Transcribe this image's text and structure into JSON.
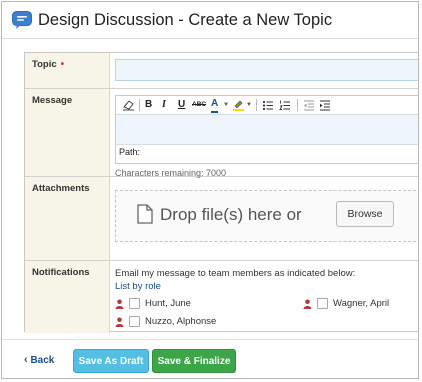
{
  "header": {
    "title": "Design Discussion - Create a New Topic",
    "icon": "chat-bubble-icon"
  },
  "form": {
    "topic": {
      "label": "Topic",
      "required_mark": "•",
      "value": ""
    },
    "message": {
      "label": "Message",
      "toolbar": {
        "items": [
          "eraser-icon",
          "bold-icon",
          "italic-icon",
          "underline-icon",
          "strikethrough-icon",
          "font-color-icon",
          "highlight-color-icon",
          "bulleted-list-icon",
          "numbered-list-icon",
          "decrease-indent-icon",
          "increase-indent-icon"
        ],
        "bold": "B",
        "italic": "I",
        "underline": "U",
        "strike": "ABC",
        "font_color": "A"
      },
      "path_label": "Path:",
      "chars_remaining": "Characters remaining: 7000"
    },
    "attachments": {
      "label": "Attachments",
      "drop_text": "Drop file(s) here or",
      "browse_label": "Browse"
    },
    "notifications": {
      "label": "Notifications",
      "instruction": "Email my message to team members as indicated below:",
      "list_link": "List by role",
      "members": [
        {
          "name": "Hunt, June",
          "checked": false
        },
        {
          "name": "Wagner, April",
          "checked": false
        },
        {
          "name": "Nuzzo, Alphonse",
          "checked": false
        }
      ]
    }
  },
  "footer": {
    "back_label": "Back",
    "back_icon": "chevron-left-icon",
    "save_draft_label": "Save As Draft",
    "save_finalize_label": "Save & Finalize"
  },
  "colors": {
    "required": "#e0303a",
    "link": "#1b4e86",
    "draft": "#52bfe3",
    "finalize": "#3ca548",
    "label_bg": "#f7f4e8"
  }
}
